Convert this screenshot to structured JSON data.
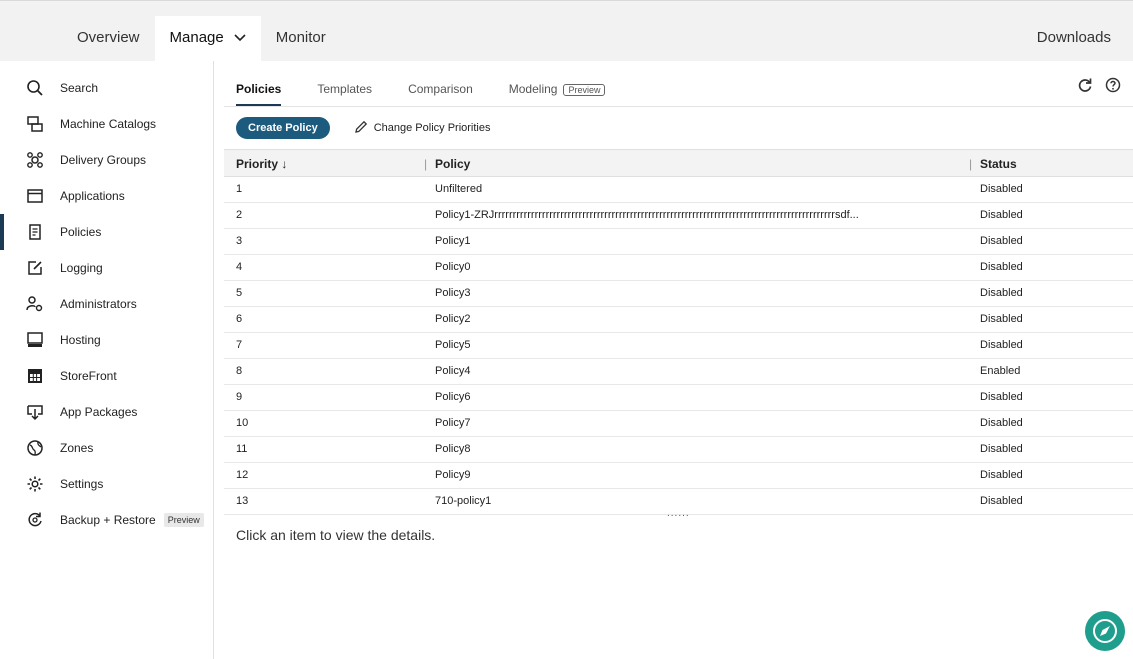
{
  "topnav": {
    "items": [
      {
        "label": "Overview"
      },
      {
        "label": "Manage"
      },
      {
        "label": "Monitor"
      }
    ],
    "downloads": "Downloads"
  },
  "sidebar": {
    "items": [
      {
        "label": "Search",
        "icon": "search-icon"
      },
      {
        "label": "Machine Catalogs",
        "icon": "machine-catalogs-icon"
      },
      {
        "label": "Delivery Groups",
        "icon": "delivery-groups-icon"
      },
      {
        "label": "Applications",
        "icon": "applications-icon"
      },
      {
        "label": "Policies",
        "icon": "policies-icon"
      },
      {
        "label": "Logging",
        "icon": "logging-icon"
      },
      {
        "label": "Administrators",
        "icon": "administrators-icon"
      },
      {
        "label": "Hosting",
        "icon": "hosting-icon"
      },
      {
        "label": "StoreFront",
        "icon": "storefront-icon"
      },
      {
        "label": "App Packages",
        "icon": "app-packages-icon"
      },
      {
        "label": "Zones",
        "icon": "zones-icon"
      },
      {
        "label": "Settings",
        "icon": "settings-icon"
      },
      {
        "label": "Backup + Restore",
        "icon": "backup-restore-icon",
        "badge": "Preview"
      }
    ]
  },
  "tabs": {
    "items": [
      {
        "label": "Policies"
      },
      {
        "label": "Templates"
      },
      {
        "label": "Comparison"
      },
      {
        "label": "Modeling",
        "badge": "Preview"
      }
    ]
  },
  "toolbar": {
    "create_label": "Create Policy",
    "priorities_label": "Change Policy Priorities"
  },
  "table": {
    "headers": {
      "priority": "Priority ↓",
      "policy": "Policy",
      "status": "Status"
    },
    "rows": [
      {
        "priority": "1",
        "policy": "Unfiltered",
        "status": "Disabled"
      },
      {
        "priority": "2",
        "policy": "Policy1-ZRJrrrrrrrrrrrrrrrrrrrrrrrrrrrrrrrrrrrrrrrrrrrrrrrrrrrrrrrrrrrrrrrrrrrrrrrrrrrrrrrrrrrrrrrrrrrrrsdf...",
        "status": "Disabled"
      },
      {
        "priority": "3",
        "policy": "Policy1",
        "status": "Disabled"
      },
      {
        "priority": "4",
        "policy": "Policy0",
        "status": "Disabled"
      },
      {
        "priority": "5",
        "policy": "Policy3",
        "status": "Disabled"
      },
      {
        "priority": "6",
        "policy": "Policy2",
        "status": "Disabled"
      },
      {
        "priority": "7",
        "policy": "Policy5",
        "status": "Disabled"
      },
      {
        "priority": "8",
        "policy": "Policy4",
        "status": "Enabled"
      },
      {
        "priority": "9",
        "policy": "Policy6",
        "status": "Disabled"
      },
      {
        "priority": "10",
        "policy": "Policy7",
        "status": "Disabled"
      },
      {
        "priority": "11",
        "policy": "Policy8",
        "status": "Disabled"
      },
      {
        "priority": "12",
        "policy": "Policy9",
        "status": "Disabled"
      },
      {
        "priority": "13",
        "policy": "710-policy1",
        "status": "Disabled"
      }
    ]
  },
  "details": {
    "placeholder": "Click an item to view the details."
  },
  "colors": {
    "accent": "#1c5a7e",
    "nav_active": "#1c3a55",
    "fab": "#1f9e8e"
  }
}
